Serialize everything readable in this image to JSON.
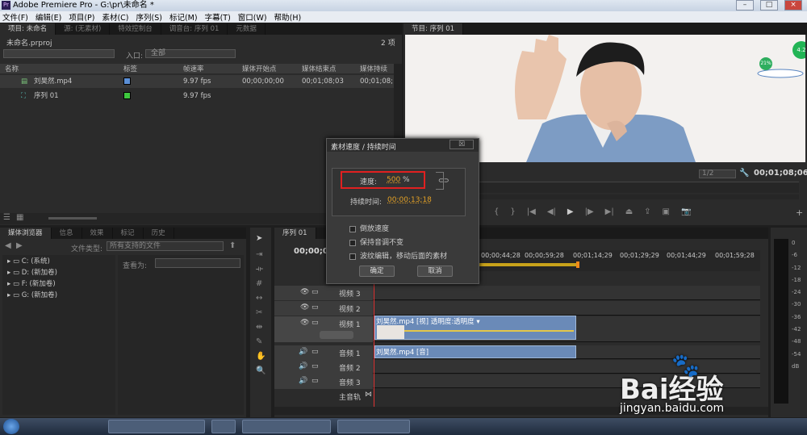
{
  "app": {
    "title": "Adobe Premiere Pro - G:\\pr\\未命名 *",
    "logo": "Pr",
    "menu": [
      "文件(F)",
      "编辑(E)",
      "项目(P)",
      "素材(C)",
      "序列(S)",
      "标记(M)",
      "字幕(T)",
      "窗口(W)",
      "帮助(H)"
    ],
    "window_controls": [
      "–",
      "□",
      "×"
    ]
  },
  "project": {
    "tabs": [
      "项目: 未命名",
      "源: (无素材)",
      "特效控制台",
      "调音台: 序列 01",
      "元数据"
    ],
    "file": "未命名.prproj",
    "count": "2 项",
    "entry_label": "入口:",
    "entry_value": "全部",
    "columns": [
      "名称",
      "标签",
      "帧速率",
      "媒体开始点",
      "媒体结束点",
      "媒体持续时间"
    ],
    "items": [
      {
        "name": "刘昊然.mp4",
        "label_color": "#5b8fd6",
        "fps": "9.97 fps",
        "start": "00;00;00;00",
        "end": "00;01;08;03",
        "dur": "00;01;08;"
      },
      {
        "name": "序列 01",
        "label_color": "#3ec83e",
        "fps": "9.97 fps",
        "start": "",
        "end": "",
        "dur": ""
      }
    ]
  },
  "program": {
    "tab": "节目: 序列 01",
    "zoom": "1/2",
    "timecode": "00;01;08;06"
  },
  "browser": {
    "tabs": [
      "媒体浏览器",
      "信息",
      "效果",
      "标记",
      "历史"
    ],
    "filetype_label": "文件类型:",
    "filetype_value": "所有支持的文件",
    "view_label": "查看为:",
    "drives": [
      "C: (系统)",
      "D: (新加卷)",
      "F: (新加卷)",
      "G: (新加卷)"
    ]
  },
  "timeline": {
    "tab": "序列 01",
    "timecode": "00;00;00",
    "ruler": [
      "00;00;44;28",
      "00;00;59;28",
      "00;01;14;29",
      "00;01;29;29",
      "00;01;44;29",
      "00;01;59;28"
    ],
    "video_tracks": [
      "视频 3",
      "视频 2",
      "视频 1"
    ],
    "audio_tracks": [
      "音频 1",
      "音频 2",
      "音频 3"
    ],
    "master": "主音轨",
    "video_clip": "刘昊然.mp4 [视] 透明度:透明度 ▾",
    "audio_clip": "刘昊然.mp4 [音]"
  },
  "dialog": {
    "title": "素材速度 / 持续时间",
    "close": "☒",
    "speed_label": "速度:",
    "speed_value": "500",
    "speed_unit": "%",
    "duration_label": "持续时间:",
    "duration_value": "00;00;13;18",
    "options": [
      "倒放速度",
      "保持音调不变",
      "波纹编辑，移动后面的素材"
    ],
    "ok": "确定",
    "cancel": "取消"
  },
  "meter": {
    "scale": [
      "0",
      "-6",
      "-12",
      "-18",
      "-24",
      "-30",
      "-36",
      "-42",
      "-48",
      "-54",
      "dB"
    ]
  },
  "overlay": {
    "percent": "21%",
    "speed_badge": "4.2"
  },
  "watermark": {
    "brand": "Bai经验",
    "url": "jingyan.baidu.com"
  }
}
